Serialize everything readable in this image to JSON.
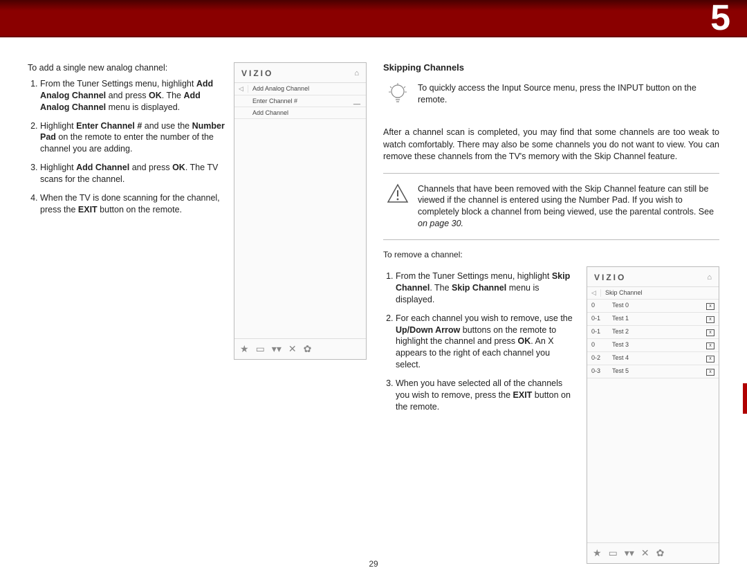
{
  "chapter": "5",
  "pageNumber": "29",
  "left": {
    "intro": "To add a single new analog channel:",
    "steps": [
      {
        "pre": "From the Tuner Settings menu, highlight ",
        "b1": "Add Analog Channel",
        "mid": " and press ",
        "b2": "OK",
        "post": ". The ",
        "b3": "Add Analog Channel",
        "tail": " menu is displayed."
      },
      {
        "pre": "Highlight ",
        "b1": "Enter Channel #",
        "mid": " and use the ",
        "b2": "Number Pad",
        "post": " on the remote to enter the number of the channel you are adding."
      },
      {
        "pre": "Highlight ",
        "b1": "Add Channel",
        "mid": " and press ",
        "b2": "OK",
        "post": ". The TV scans for the channel."
      },
      {
        "pre": "When the TV is done scanning for the channel, press the ",
        "b1": "EXIT",
        "post": " button on the remote."
      }
    ]
  },
  "panel1": {
    "logo": "VIZIO",
    "back": "◁",
    "home": "⌂",
    "title": "Add Analog Channel",
    "row2a": "Enter Channel #",
    "row2b": "__",
    "row3": "Add Channel",
    "footer": [
      "★",
      "▭",
      "▾▾",
      "✕",
      "✿"
    ]
  },
  "right": {
    "title": "Skipping Channels",
    "tip": "To quickly access the Input Source menu, press the INPUT button on the remote.",
    "para": "After a channel scan is completed, you may find that some channels are too weak to watch comfortably. There may also be some channels you do not want to view. You can remove these channels from the TV's memory with the Skip Channel feature.",
    "warn": {
      "text": "Channels that have been removed with the Skip Channel feature can still be viewed if the channel is entered using the Number Pad. If you wish to completely block a channel from being viewed, use the parental controls. See",
      "ref": "  on page 30."
    },
    "intro2": "To remove a channel:",
    "steps": [
      {
        "pre": "From the Tuner Settings menu, highlight ",
        "b1": "Skip Channel",
        "post": ". The ",
        "b2": "Skip Channel",
        "tail": " menu is displayed."
      },
      {
        "pre": "For each channel you wish to remove, use the ",
        "b1": "Up/Down Arrow",
        "mid": " buttons on the remote to highlight the channel and press ",
        "b2": "OK",
        "post": ". An X appears to the right of each channel you select."
      },
      {
        "pre": "When you have selected all of the channels you wish to remove, press the ",
        "b1": "EXIT",
        "post": " button on the remote."
      }
    ]
  },
  "panel2": {
    "logo": "VIZIO",
    "back": "◁",
    "home": "⌂",
    "title": "Skip Channel",
    "rows": [
      {
        "c1": "0",
        "c2": "Test 0",
        "x": "x"
      },
      {
        "c1": "0-1",
        "c2": "Test 1",
        "x": "x"
      },
      {
        "c1": "0-1",
        "c2": "Test 2",
        "x": "x"
      },
      {
        "c1": "0",
        "c2": "Test 3",
        "x": "x"
      },
      {
        "c1": "0-2",
        "c2": "Test 4",
        "x": "x"
      },
      {
        "c1": "0-3",
        "c2": "Test 5",
        "x": "x"
      }
    ],
    "footer": [
      "★",
      "▭",
      "▾▾",
      "✕",
      "✿"
    ]
  }
}
